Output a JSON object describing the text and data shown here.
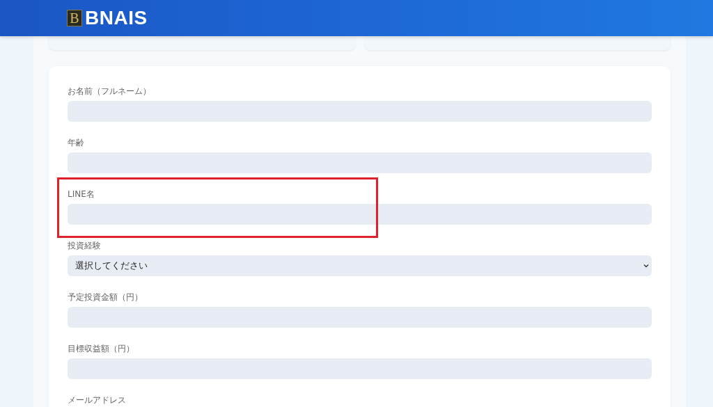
{
  "header": {
    "logo_letter": "B",
    "brand": "BNAIS"
  },
  "form": {
    "fields": [
      {
        "kind": "text",
        "label": "お名前（フルネーム）",
        "highlighted": false
      },
      {
        "kind": "text",
        "label": "年齢",
        "highlighted": false
      },
      {
        "kind": "text",
        "label": "LINE名",
        "highlighted": true
      },
      {
        "kind": "select",
        "label": "投資経験",
        "value": "選択してください",
        "highlighted": false
      },
      {
        "kind": "text",
        "label": "予定投資金額（円）",
        "highlighted": false
      },
      {
        "kind": "text",
        "label": "目標収益額（円）",
        "highlighted": false
      },
      {
        "kind": "label",
        "label": "メールアドレス",
        "highlighted": false
      }
    ]
  }
}
